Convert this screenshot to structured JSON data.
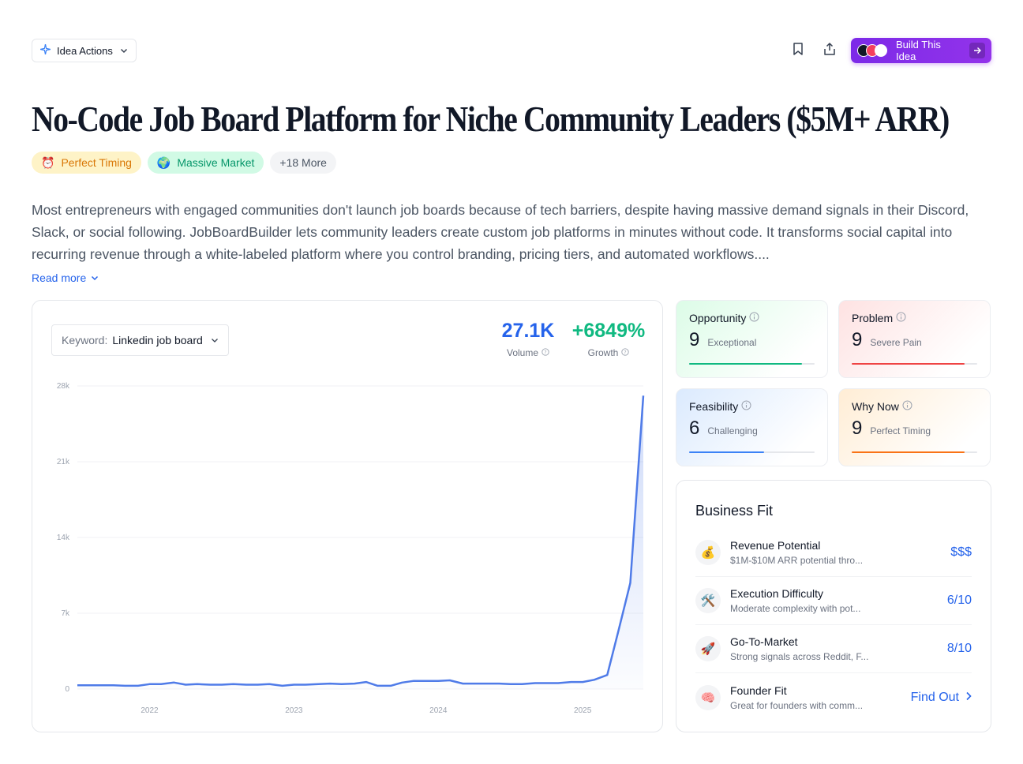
{
  "toolbar": {
    "idea_actions_label": "Idea Actions",
    "build_label": "Build This Idea"
  },
  "title": "No-Code Job Board Platform for Niche Community Leaders ($5M+ ARR)",
  "tags": [
    {
      "emoji": "⏰",
      "label": "Perfect Timing"
    },
    {
      "emoji": "🌍",
      "label": "Massive Market"
    },
    {
      "label": "+18 More"
    }
  ],
  "description": "Most entrepreneurs with engaged communities don't launch job boards because of tech barriers, despite having massive demand signals in their Discord, Slack, or social following. JobBoardBuilder lets community leaders create custom job platforms in minutes without code. It transforms social capital into recurring revenue through a white-labeled platform where you control branding, pricing tiers, and automated workflows....",
  "read_more": "Read more",
  "keyword": {
    "label": "Keyword:",
    "value": "Linkedin job board"
  },
  "stats": {
    "volume": {
      "value": "27.1K",
      "label": "Volume"
    },
    "growth": {
      "value": "+6849%",
      "label": "Growth"
    }
  },
  "chart_data": {
    "type": "area",
    "y_ticks": [
      "28k",
      "21k",
      "14k",
      "7k",
      "0"
    ],
    "ylim": [
      0,
      28000
    ],
    "x_ticks": [
      "2022",
      "2023",
      "2024",
      "2025"
    ],
    "x_tick_dates": [
      2022.0,
      2023.0,
      2024.0,
      2025.0
    ],
    "xlim": [
      2021.5,
      2025.42
    ],
    "color": "#4f7be8",
    "series": [
      {
        "x": [
          2021.5,
          2021.58,
          2021.67,
          2021.75,
          2021.83,
          2021.92,
          2022.0,
          2022.08,
          2022.17,
          2022.25,
          2022.33,
          2022.42,
          2022.5,
          2022.58,
          2022.67,
          2022.75,
          2022.83,
          2022.92,
          2023.0,
          2023.08,
          2023.17,
          2023.25,
          2023.33,
          2023.42,
          2023.5,
          2023.58,
          2023.67,
          2023.75,
          2023.83,
          2023.92,
          2024.0,
          2024.08,
          2024.17,
          2024.25,
          2024.33,
          2024.42,
          2024.5,
          2024.58,
          2024.67,
          2024.75,
          2024.83,
          2024.92,
          2025.0,
          2025.08,
          2025.17,
          2025.25,
          2025.33,
          2025.42
        ],
        "values": [
          350,
          350,
          350,
          350,
          300,
          300,
          450,
          450,
          600,
          400,
          450,
          400,
          400,
          450,
          400,
          400,
          450,
          300,
          400,
          400,
          450,
          500,
          450,
          500,
          650,
          300,
          300,
          600,
          750,
          750,
          750,
          800,
          500,
          500,
          500,
          500,
          450,
          450,
          550,
          550,
          550,
          650,
          650,
          850,
          1300,
          5500,
          9800,
          27100
        ]
      }
    ]
  },
  "scores": [
    {
      "key": "opp",
      "title": "Opportunity",
      "value": "9",
      "label": "Exceptional",
      "fill": 0.9,
      "color": "#10b981"
    },
    {
      "key": "prob",
      "title": "Problem",
      "value": "9",
      "label": "Severe Pain",
      "fill": 0.9,
      "color": "#ef4444"
    },
    {
      "key": "feas",
      "title": "Feasibility",
      "value": "6",
      "label": "Challenging",
      "fill": 0.6,
      "color": "#3b82f6"
    },
    {
      "key": "why",
      "title": "Why Now",
      "value": "9",
      "label": "Perfect Timing",
      "fill": 0.9,
      "color": "#f97316"
    }
  ],
  "business_fit": {
    "title": "Business Fit",
    "items": [
      {
        "icon": "💰",
        "name": "Revenue Potential",
        "desc": "$1M-$10M ARR potential thro...",
        "value": "$$$"
      },
      {
        "icon": "🛠️",
        "name": "Execution Difficulty",
        "desc": "Moderate complexity with pot...",
        "value": "6/10"
      },
      {
        "icon": "🚀",
        "name": "Go-To-Market",
        "desc": "Strong signals across Reddit, F...",
        "value": "8/10"
      },
      {
        "icon": "🧠",
        "name": "Founder Fit",
        "desc": "Great for founders with comm...",
        "value": "Find Out"
      }
    ]
  }
}
